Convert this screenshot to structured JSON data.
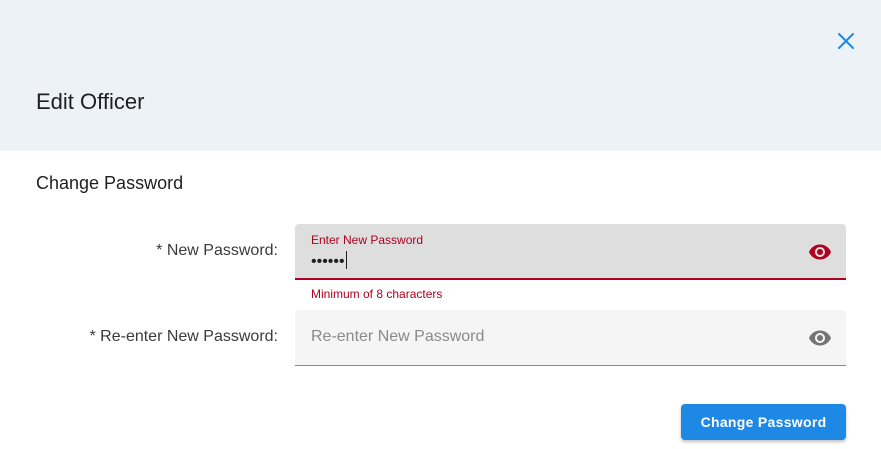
{
  "dialog": {
    "title": "Edit Officer",
    "close_icon": "close-icon"
  },
  "section": {
    "title": "Change Password"
  },
  "new_password": {
    "label": "* New Password:",
    "floating_label": "Enter New Password",
    "value": "••••••",
    "helper_text": "Minimum of 8 characters",
    "visibility_icon": "eye-icon",
    "state": "error"
  },
  "reenter_password": {
    "label": "* Re-enter New Password:",
    "placeholder": "Re-enter New Password",
    "value": "",
    "visibility_icon": "eye-icon"
  },
  "actions": {
    "submit_label": "Change Password"
  },
  "colors": {
    "header_bg": "#edf2f7",
    "error": "#b00020",
    "primary": "#1e88e5",
    "icon_muted": "#757575"
  }
}
